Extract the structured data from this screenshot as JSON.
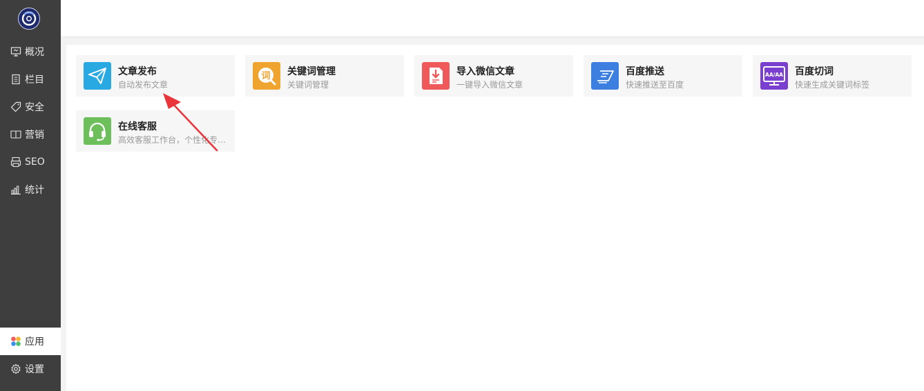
{
  "sidebar": {
    "items": [
      {
        "label": "概况",
        "icon": "monitor-icon"
      },
      {
        "label": "栏目",
        "icon": "document-icon"
      },
      {
        "label": "安全",
        "icon": "tag-icon"
      },
      {
        "label": "营销",
        "icon": "book-icon"
      },
      {
        "label": "SEO",
        "icon": "printer-icon"
      },
      {
        "label": "统计",
        "icon": "bar-chart-icon"
      },
      {
        "label": "应用",
        "icon": "flower-icon",
        "active": true
      },
      {
        "label": "设置",
        "icon": "gear-icon"
      }
    ]
  },
  "apps": [
    {
      "title": "文章发布",
      "desc": "自动发布文章",
      "icon": "paper-plane-icon",
      "color": "#29a9e1"
    },
    {
      "title": "关键词管理",
      "desc": "关键词管理",
      "icon": "keyword-search-icon",
      "color": "#f0a430"
    },
    {
      "title": "导入微信文章",
      "desc": "一键导入微信文章",
      "icon": "import-doc-icon",
      "color": "#f0595a"
    },
    {
      "title": "百度推送",
      "desc": "快速推送至百度",
      "icon": "push-send-icon",
      "color": "#3d7fe0"
    },
    {
      "title": "百度切词",
      "desc": "快速生成关键词标签",
      "icon": "word-split-icon",
      "color": "#7b3fd0",
      "icon_text": "AA/AA"
    },
    {
      "title": "在线客服",
      "desc": "高效客服工作台，个性化专属服务",
      "icon": "headset-icon",
      "color": "#6cbf5a"
    }
  ],
  "colors": {
    "sidebar_bg": "#3e3e3e",
    "arrow": "#e8363b"
  }
}
